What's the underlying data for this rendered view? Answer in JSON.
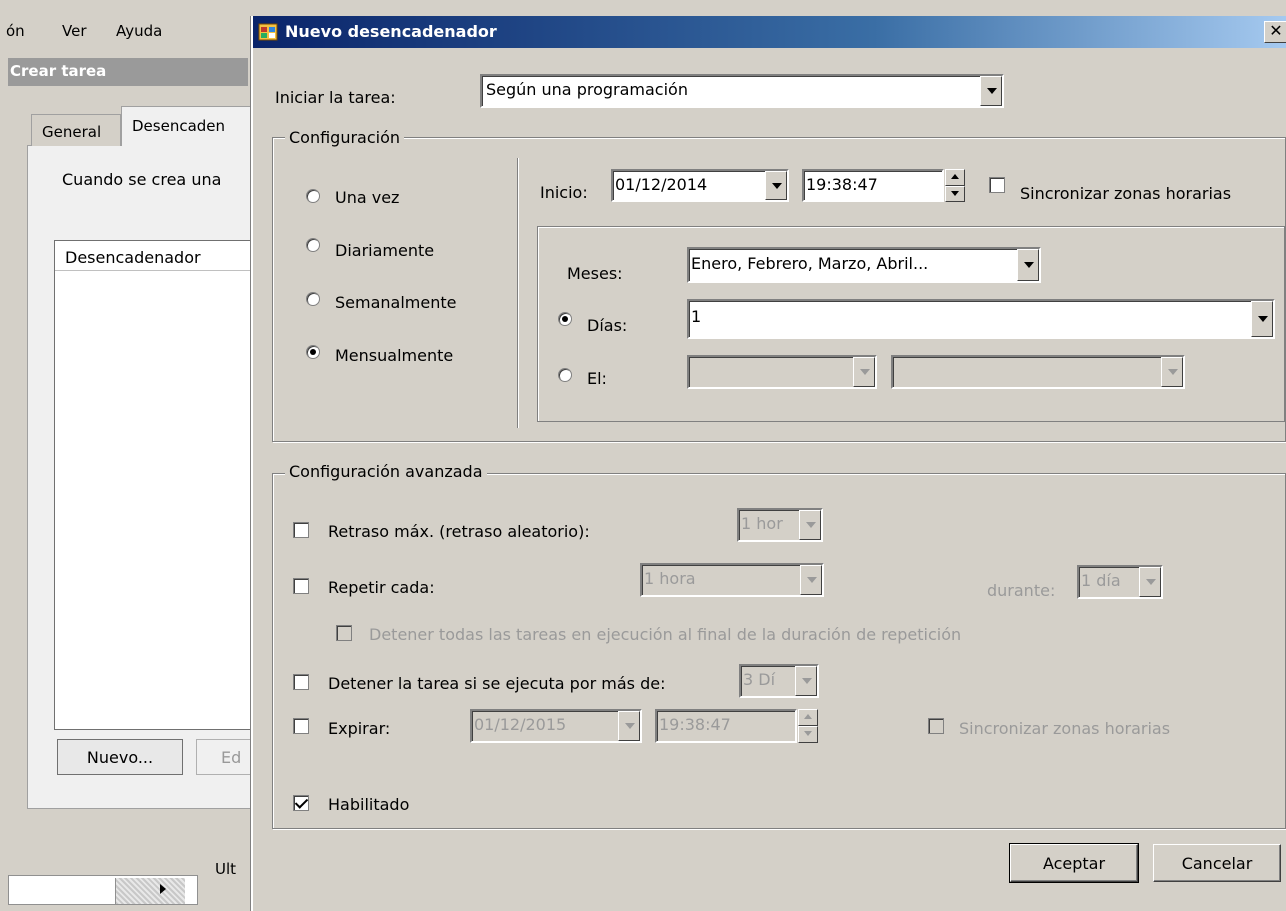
{
  "background": {
    "menu": [
      "ón",
      "Ver",
      "Ayuda"
    ],
    "window_title": "Crear tarea",
    "tabs": [
      "General",
      "Desencaden"
    ],
    "description": "Cuando se crea una",
    "list_header": "Desencadenador",
    "new_button": "Nuevo...",
    "edit_button": "Ed",
    "bottom_label": "Ult"
  },
  "dialog": {
    "title": "Nuevo desencadenador",
    "close_glyph": "✕",
    "start_task_label": "Iniciar la tarea:",
    "start_task_value": "Según una programación",
    "config_group": "Configuración",
    "schedule_options": [
      "Una vez",
      "Diariamente",
      "Semanalmente",
      "Mensualmente"
    ],
    "selected_schedule": "Mensualmente",
    "start_label": "Inicio:",
    "start_date": "01/12/2014",
    "start_time": "19:38:47",
    "sync_timezones_label": "Sincronizar zonas horarias",
    "sync_timezones_checked": false,
    "months_label": "Meses:",
    "months_value": "Enero, Febrero, Marzo, Abril...",
    "days_label": "Días:",
    "days_value": "1",
    "days_selected": true,
    "on_label": "El:",
    "advanced_group": "Configuración avanzada",
    "delay_label": "Retraso máx. (retraso aleatorio):",
    "delay_value": "1 hor",
    "repeat_label": "Repetir cada:",
    "repeat_value": "1 hora",
    "during_label": "durante:",
    "during_value": "1 día",
    "stop_all_label": "Detener todas las tareas en ejecución al final de la duración de repetición",
    "stop_if_label": "Detener la tarea si se ejecuta por más de:",
    "stop_if_value": "3 Dí",
    "expire_label": "Expirar:",
    "expire_date": "01/12/2015",
    "expire_time": "19:38:47",
    "expire_sync_label": "Sincronizar zonas horarias",
    "enabled_label": "Habilitado",
    "enabled_checked": true,
    "ok_button": "Aceptar",
    "cancel_button": "Cancelar"
  }
}
